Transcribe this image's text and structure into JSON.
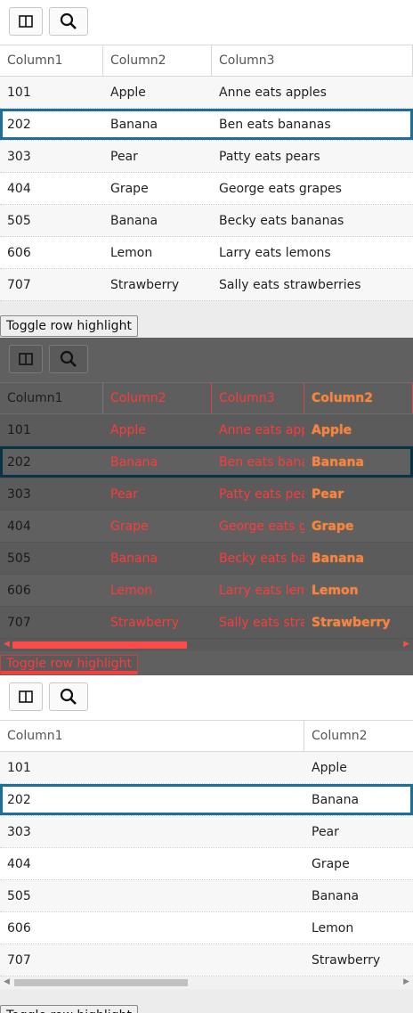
{
  "toolbar": {
    "columns_icon": "columns-icon",
    "search_icon": "search-icon"
  },
  "toggle_label": "Toggle row highlight",
  "headers": [
    "Column1",
    "Column2",
    "Column3"
  ],
  "dark_extra_header": "Column2",
  "rows": [
    [
      "101",
      "Apple",
      "Anne eats apples"
    ],
    [
      "202",
      "Banana",
      "Ben eats bananas"
    ],
    [
      "303",
      "Pear",
      "Patty eats pears"
    ],
    [
      "404",
      "Grape",
      "George eats grapes"
    ],
    [
      "505",
      "Banana",
      "Becky eats bananas"
    ],
    [
      "606",
      "Lemon",
      "Larry eats lemons"
    ],
    [
      "707",
      "Strawberry",
      "Sally eats strawberries"
    ]
  ],
  "highlighted_row_index": 1,
  "colors": {
    "highlight": "#1b6f9a",
    "dark_bg": "#606060",
    "error_red": "#ff3a3a"
  }
}
